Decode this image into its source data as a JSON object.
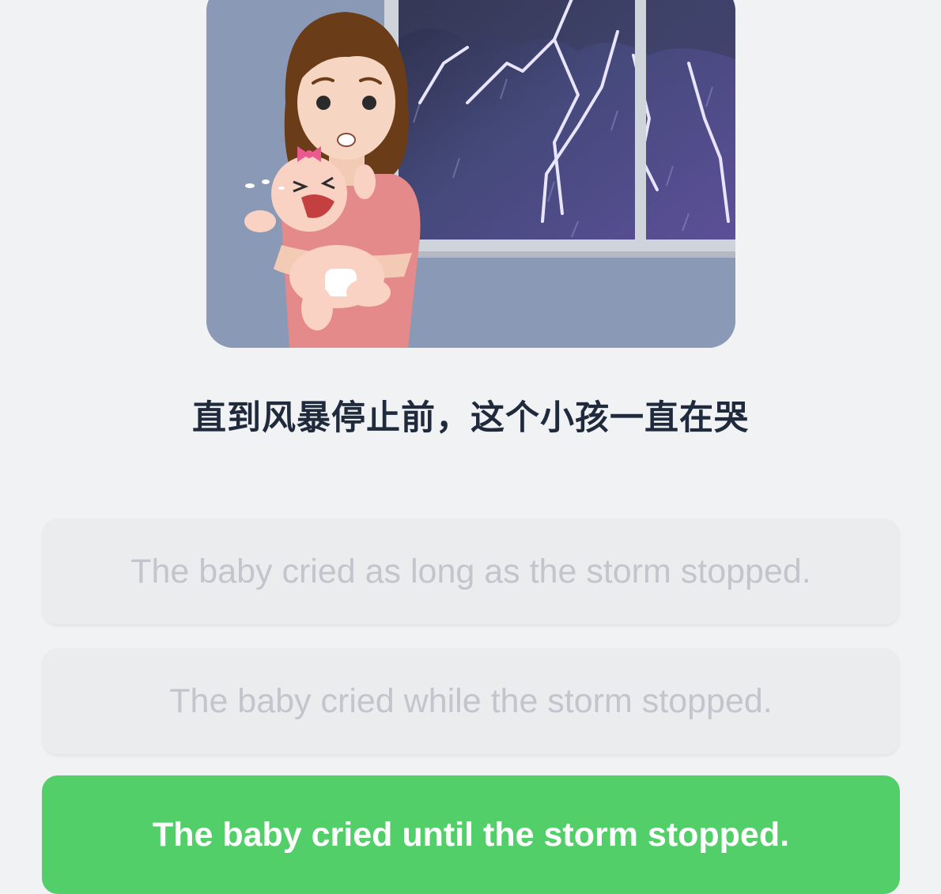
{
  "illustration": {
    "description_icon": "mother-holding-crying-baby-during-storm-illustration"
  },
  "question": {
    "prompt": "直到风暴停止前，这个小孩一直在哭"
  },
  "options": [
    {
      "label": "The baby cried as long as the storm stopped.",
      "state": "disabled"
    },
    {
      "label": "The baby cried while the storm stopped.",
      "state": "disabled"
    },
    {
      "label": "The baby cried until the storm stopped.",
      "state": "correct"
    }
  ],
  "colors": {
    "background": "#f1f2f4",
    "correct": "#53cf69",
    "disabled_bg": "#ebecee",
    "disabled_text": "#c2c5cc",
    "prompt_text": "#1f2a3c"
  }
}
